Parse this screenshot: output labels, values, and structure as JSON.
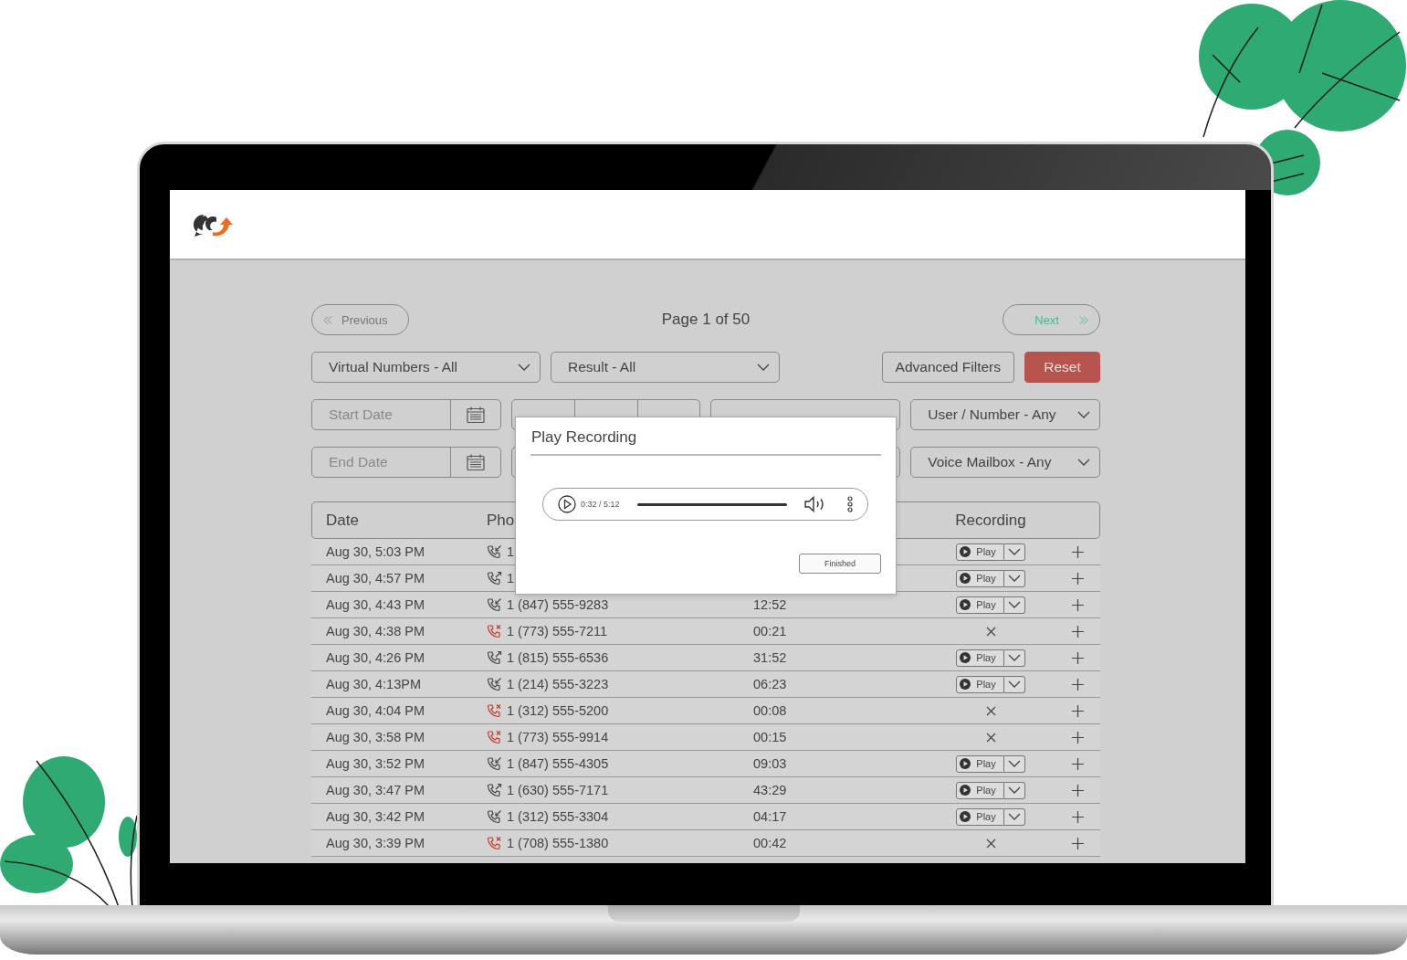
{
  "pager": {
    "previous": "Previous",
    "page_label": "Page 1 of 50",
    "next": "Next"
  },
  "filters": {
    "virtual_numbers": "Virtual Numbers - All",
    "result": "Result - All",
    "advanced": "Advanced Filters",
    "reset": "Reset",
    "start_date": {
      "placeholder": "Start Date"
    },
    "user_number": "User / Number - Any",
    "end_date": {
      "placeholder": "End Date"
    },
    "voice_mailbox": "Voice Mailbox - Any"
  },
  "table": {
    "columns": [
      {
        "label": "Date"
      },
      {
        "label": "Pho"
      },
      {
        "label": "Recording"
      }
    ],
    "rows": [
      {
        "date": "Aug 30, 5:03 PM",
        "kind": "incoming",
        "phone": "1",
        "recording": true,
        "play_label": "Play"
      },
      {
        "date": "Aug 30, 4:57 PM",
        "kind": "outgoing",
        "phone": "1",
        "recording": true,
        "play_label": "Play"
      },
      {
        "date": "Aug 30, 4:43 PM",
        "kind": "incoming",
        "phone": "1 (847) 555-9283",
        "duration": "12:52",
        "recording": true,
        "play_label": "Play"
      },
      {
        "date": "Aug 30, 4:38 PM",
        "kind": "missed",
        "phone": "1 (773) 555-7211",
        "duration": "00:21",
        "recording": false
      },
      {
        "date": "Aug 30, 4:26 PM",
        "kind": "outgoing",
        "phone": "1 (815) 555-6536",
        "duration": "31:52",
        "recording": true,
        "play_label": "Play"
      },
      {
        "date": "Aug 30, 4:13PM",
        "kind": "incoming",
        "phone": "1 (214) 555-3223",
        "duration": "06:23",
        "recording": true,
        "play_label": "Play"
      },
      {
        "date": "Aug 30, 4:04 PM",
        "kind": "missed",
        "phone": "1 (312) 555-5200",
        "duration": "00:08",
        "recording": false
      },
      {
        "date": "Aug 30, 3:58 PM",
        "kind": "missed",
        "phone": "1 (773) 555-9914",
        "duration": "00:15",
        "recording": false
      },
      {
        "date": "Aug 30, 3:52 PM",
        "kind": "incoming",
        "phone": "1 (847) 555-4305",
        "duration": "09:03",
        "recording": true,
        "play_label": "Play"
      },
      {
        "date": "Aug 30, 3:47 PM",
        "kind": "outgoing",
        "phone": "1 (630) 555-7171",
        "duration": "43:29",
        "recording": true,
        "play_label": "Play"
      },
      {
        "date": "Aug 30, 3:42 PM",
        "kind": "incoming",
        "phone": "1 (312) 555-3304",
        "duration": "04:17",
        "recording": true,
        "play_label": "Play"
      },
      {
        "date": "Aug 30, 3:39 PM",
        "kind": "missed",
        "phone": "1 (708) 555-1380",
        "duration": "00:42",
        "recording": false
      }
    ]
  },
  "modal": {
    "title": "Play Recording",
    "time": "0:32 / 5:12",
    "button": "Finished"
  }
}
